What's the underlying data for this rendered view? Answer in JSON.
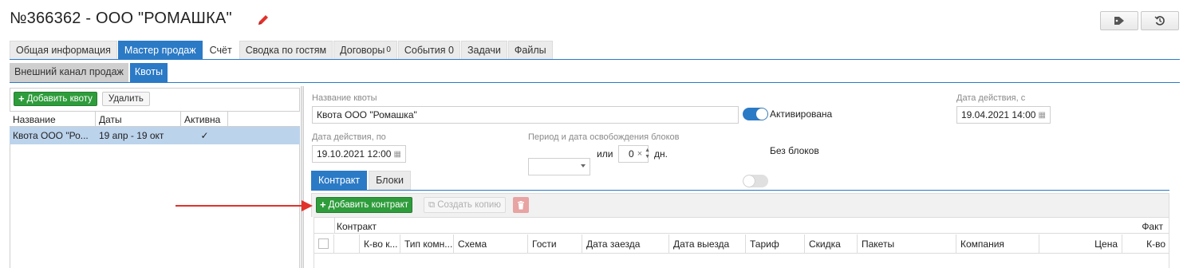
{
  "header": {
    "title": "№366362 - ООО \"РОМАШКА\""
  },
  "main_tabs": [
    {
      "label": "Общая информация",
      "badge": ""
    },
    {
      "label": "Мастер продаж",
      "badge": ""
    },
    {
      "label": "Счёт",
      "badge": ""
    },
    {
      "label": "Сводка по гостям",
      "badge": ""
    },
    {
      "label": "Договоры",
      "badge": "0"
    },
    {
      "label": "События",
      "badge": "0"
    },
    {
      "label": "Задачи",
      "badge": ""
    },
    {
      "label": "Файлы",
      "badge": ""
    }
  ],
  "sub_tabs": [
    {
      "label": "Внешний канал продаж"
    },
    {
      "label": "Квоты"
    }
  ],
  "left": {
    "add_label": "Добавить квоту",
    "delete_label": "Удалить",
    "columns": [
      "Название",
      "Даты",
      "Активна"
    ],
    "rows": [
      {
        "name": "Квота ООО \"Ро...",
        "dates": "19 апр - 19 окт",
        "active": "✓"
      }
    ]
  },
  "form": {
    "quota_name_label": "Название квоты",
    "quota_name_value": "Квота ООО \"Ромашка\"",
    "activated_label": "Активирована",
    "date_from_label": "Дата действия, с",
    "date_from_value": "19.04.2021 14:00",
    "date_to_label": "Дата действия, по",
    "date_to_value": "19.10.2021 12:00",
    "period_label": "Период и дата освобождения блоков",
    "or_label": "или",
    "days_value": "0",
    "days_unit": "дн.",
    "no_blocks_label": "Без блоков"
  },
  "inner_tabs": [
    {
      "label": "Контракт"
    },
    {
      "label": "Блоки"
    }
  ],
  "contract": {
    "add_label": "Добавить контракт",
    "copy_label": "Создать копию",
    "group_header": "Контракт",
    "fact_header": "Факт",
    "columns": [
      "К-во к...",
      "Тип комн...",
      "Схема",
      "Гости",
      "Дата заезда",
      "Дата выезда",
      "Тариф",
      "Скидка",
      "Пакеты",
      "Компания",
      "Цена",
      "К-во"
    ]
  },
  "colors": {
    "accent": "#2b7ac6",
    "green": "#2e9c3b",
    "selected_row": "#bcd3ec",
    "arrow": "#e0322b",
    "pencil": "#e0322b"
  }
}
